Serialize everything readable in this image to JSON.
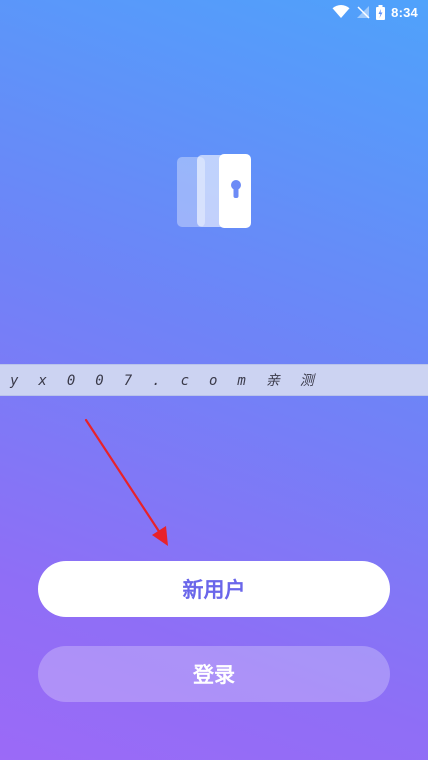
{
  "status_bar": {
    "time": "8:34",
    "icons": [
      "wifi-icon",
      "signal-icon",
      "battery-charging-icon"
    ]
  },
  "app": {
    "logo_icon": "door-lock-icon"
  },
  "watermark": {
    "text": "yx007.com亲测"
  },
  "overlay": {
    "arrow_icon": "red-arrow-icon",
    "arrow_color": "#e8222a"
  },
  "actions": {
    "new_user_label": "新用户",
    "login_label": "登录"
  },
  "colors": {
    "gradient_top": "#4fa2fb",
    "gradient_bottom": "#9b6af7",
    "primary_text": "#6a66ea"
  }
}
